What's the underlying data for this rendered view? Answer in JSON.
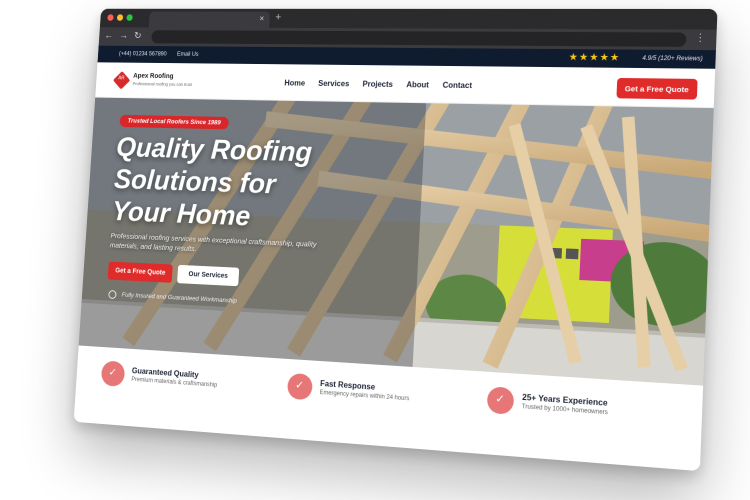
{
  "browser": {
    "tab_close": "×",
    "new_tab": "+",
    "nav_back": "←",
    "nav_forward": "→",
    "nav_reload": "↻",
    "menu": "⋮",
    "colors": {
      "red": "#ff5f57",
      "yellow": "#febc2e",
      "green": "#28c840"
    }
  },
  "topbar": {
    "phone": "(+44) 01234 567890",
    "email": "Email Us",
    "stars": "★★★★★",
    "rating": "4.9/5 (120+ Reviews)"
  },
  "header": {
    "logo_name": "Apex Roofing",
    "logo_mark": "AR",
    "logo_tagline": "Professional roofing you can trust",
    "nav": [
      "Home",
      "Services",
      "Projects",
      "About",
      "Contact"
    ],
    "cta": "Get a Free Quote"
  },
  "hero": {
    "badge": "Trusted Local Roofers Since 1989",
    "headline_line1": "Quality Roofing",
    "headline_line2": "Solutions for",
    "headline_line3": "Your Home",
    "subtext": "Professional roofing services with exceptional craftsmanship, quality materials, and lasting results.",
    "primary_cta": "Get a Free Quote",
    "secondary_cta": "Our Services",
    "licensed_text": "Fully Insured and Guaranteed Workmanship"
  },
  "features": [
    {
      "title": "Guaranteed Quality",
      "desc": "Premium materials & craftsmanship"
    },
    {
      "title": "Fast Response",
      "desc": "Emergency repairs within 24 hours"
    },
    {
      "title": "25+ Years Experience",
      "desc": "Trusted by 1000+ homeowners"
    }
  ],
  "colors": {
    "accent": "#e02b2b",
    "topbar_bg": "#0f1b2e",
    "feature_icon": "#e77777"
  }
}
